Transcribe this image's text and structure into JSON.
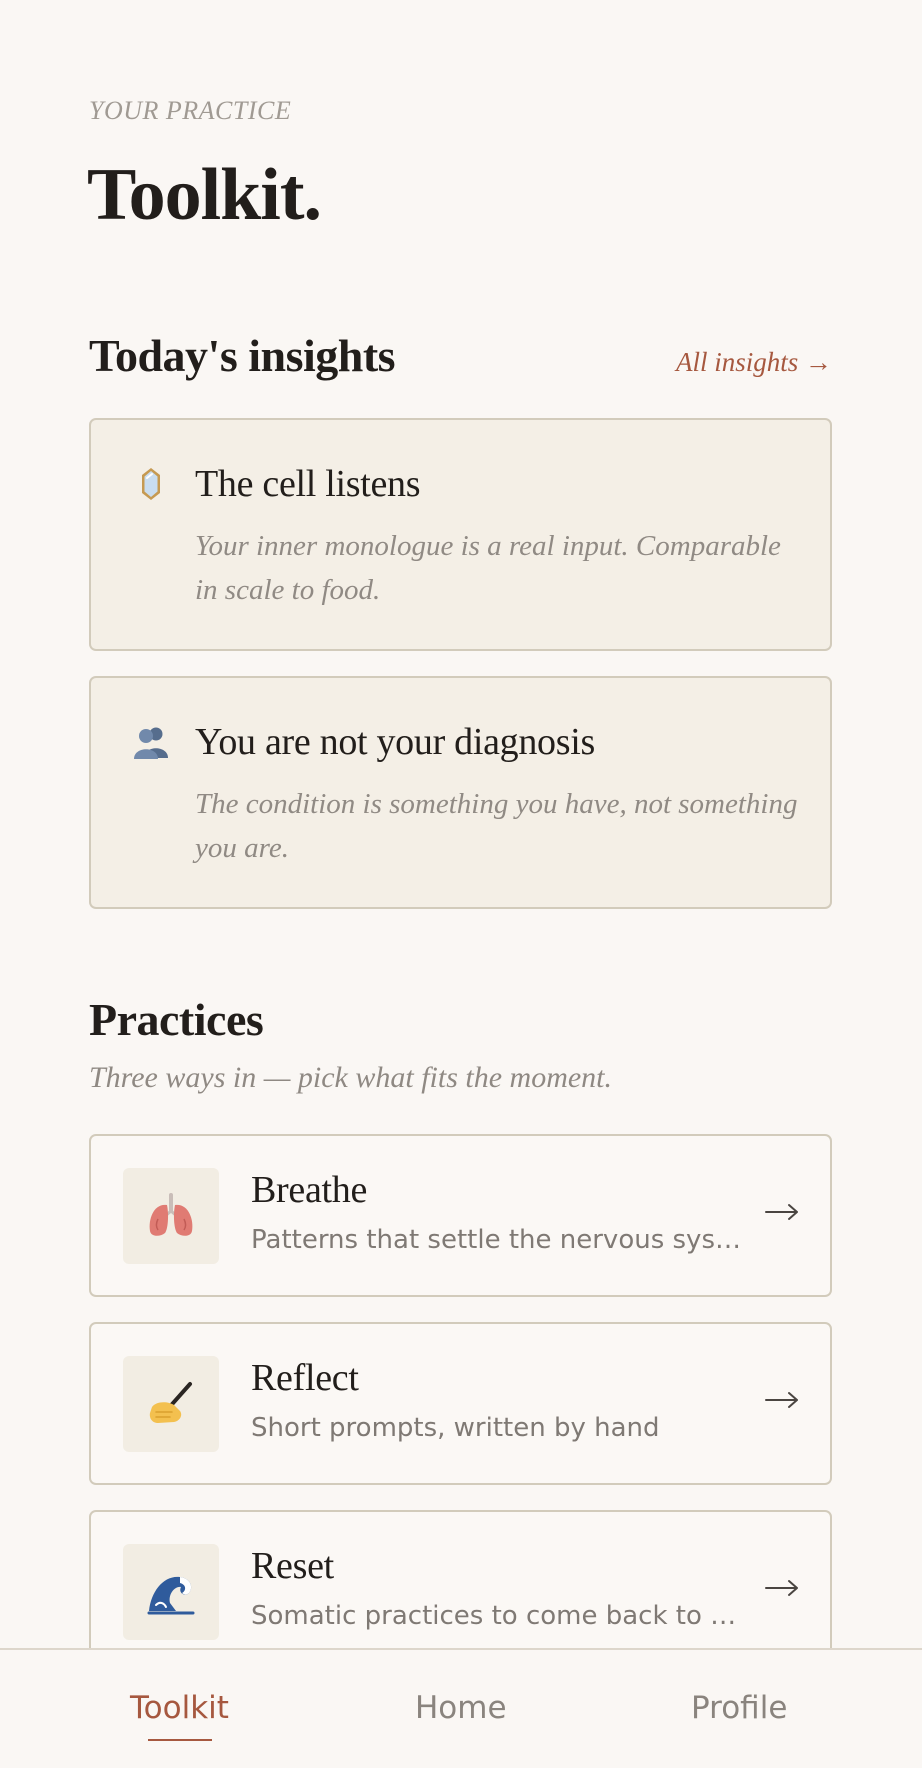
{
  "header": {
    "eyebrow": "YOUR PRACTICE",
    "title": "Toolkit."
  },
  "insights": {
    "heading": "Today's insights",
    "all_link": "All insights →",
    "items": [
      {
        "icon": "mirror-icon",
        "title": "The cell listens",
        "body": "Your inner monologue is a real input. Comparable in scale to food."
      },
      {
        "icon": "people-icon",
        "title": "You are not your diagnosis",
        "body": "The condition is something you have, not something you are."
      }
    ]
  },
  "practices": {
    "heading": "Practices",
    "subtitle": "Three ways in — pick what fits the moment.",
    "items": [
      {
        "icon": "lungs-icon",
        "title": "Breathe",
        "description": "Patterns that settle the nervous system"
      },
      {
        "icon": "writing-hand-icon",
        "title": "Reflect",
        "description": "Short prompts, written by hand"
      },
      {
        "icon": "wave-icon",
        "title": "Reset",
        "description": "Somatic practices to come back to the body"
      }
    ]
  },
  "tabbar": {
    "tabs": [
      {
        "label": "Toolkit",
        "active": true
      },
      {
        "label": "Home",
        "active": false
      },
      {
        "label": "Profile",
        "active": false
      }
    ]
  },
  "colors": {
    "background": "#faf7f4",
    "card": "#f4efe6",
    "border": "#d2cbbb",
    "accent": "#a6583f",
    "text": "#221e1b",
    "muted": "#908a84"
  }
}
